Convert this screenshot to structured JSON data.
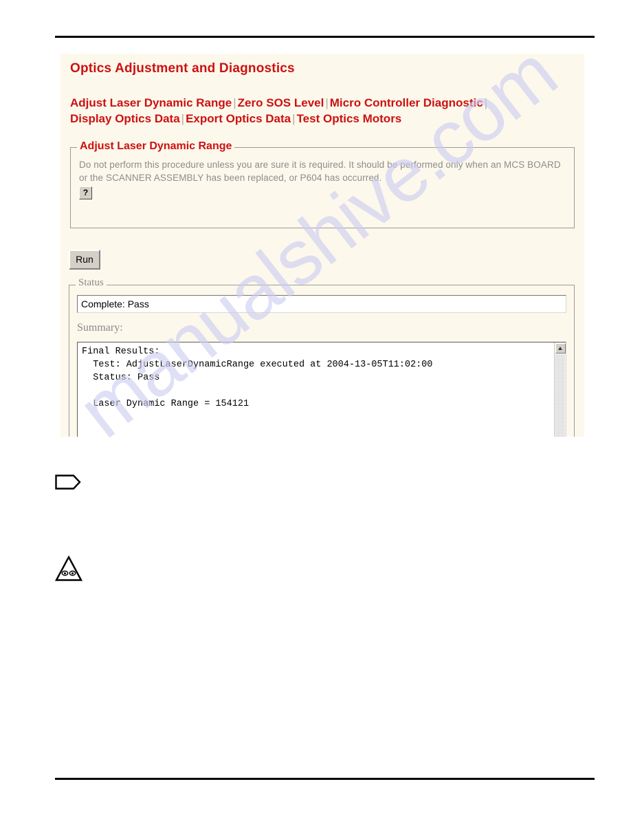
{
  "page": {
    "watermark": "manualshive.com"
  },
  "panel": {
    "title": "Optics Adjustment and Diagnostics",
    "nav": {
      "separator": "|",
      "links": [
        {
          "label": "Adjust Laser Dynamic Range"
        },
        {
          "label": "Zero SOS Level"
        },
        {
          "label": "Micro Controller Diagnostic"
        },
        {
          "label": "Display Optics Data"
        },
        {
          "label": "Export Optics Data"
        },
        {
          "label": "Test Optics Motors"
        }
      ]
    },
    "adjust_fieldset": {
      "legend": "Adjust Laser Dynamic Range",
      "description": "Do not perform this procedure unless you are sure it is required. It should be performed only when an MCS BOARD or the SCANNER ASSEMBLY has been replaced, or P604 has occurred.",
      "help_label": "?"
    },
    "run_button": {
      "label": "Run"
    },
    "status_fieldset": {
      "legend": "Status",
      "status_value": "Complete: Pass",
      "summary_label": "Summary:",
      "summary_text": "Final Results:\n  Test: AdjustLaserDynamicRange executed at 2004-13-05T11:02:00\n  Status: Pass\n\n  Laser Dynamic Range = 154121"
    }
  },
  "colors": {
    "heading_red": "#cc1111",
    "panel_background": "#fdf8ec",
    "watermark": "#ccccf2"
  }
}
